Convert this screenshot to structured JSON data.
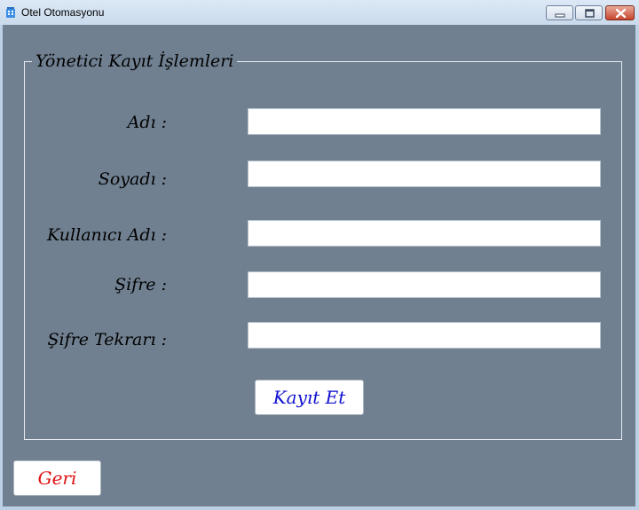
{
  "window": {
    "title": "Otel Otomasyonu",
    "icon": "building-icon"
  },
  "group": {
    "title": "Yönetici Kayıt İşlemleri"
  },
  "form": {
    "ad_label": "Adı :",
    "soyad_label": "Soyadı :",
    "kullanici_label": "Kullanıcı Adı :",
    "sifre_label": "Şifre :",
    "sifre_tekrar_label": "Şifre Tekrarı :",
    "ad_value": "",
    "soyad_value": "",
    "kullanici_value": "",
    "sifre_value": "",
    "sifre_tekrar_value": ""
  },
  "buttons": {
    "save_label": "Kayıt Et",
    "back_label": "Geri"
  },
  "colors": {
    "background": "#708090",
    "save_text": "#1010d0",
    "back_text": "#e01010"
  }
}
